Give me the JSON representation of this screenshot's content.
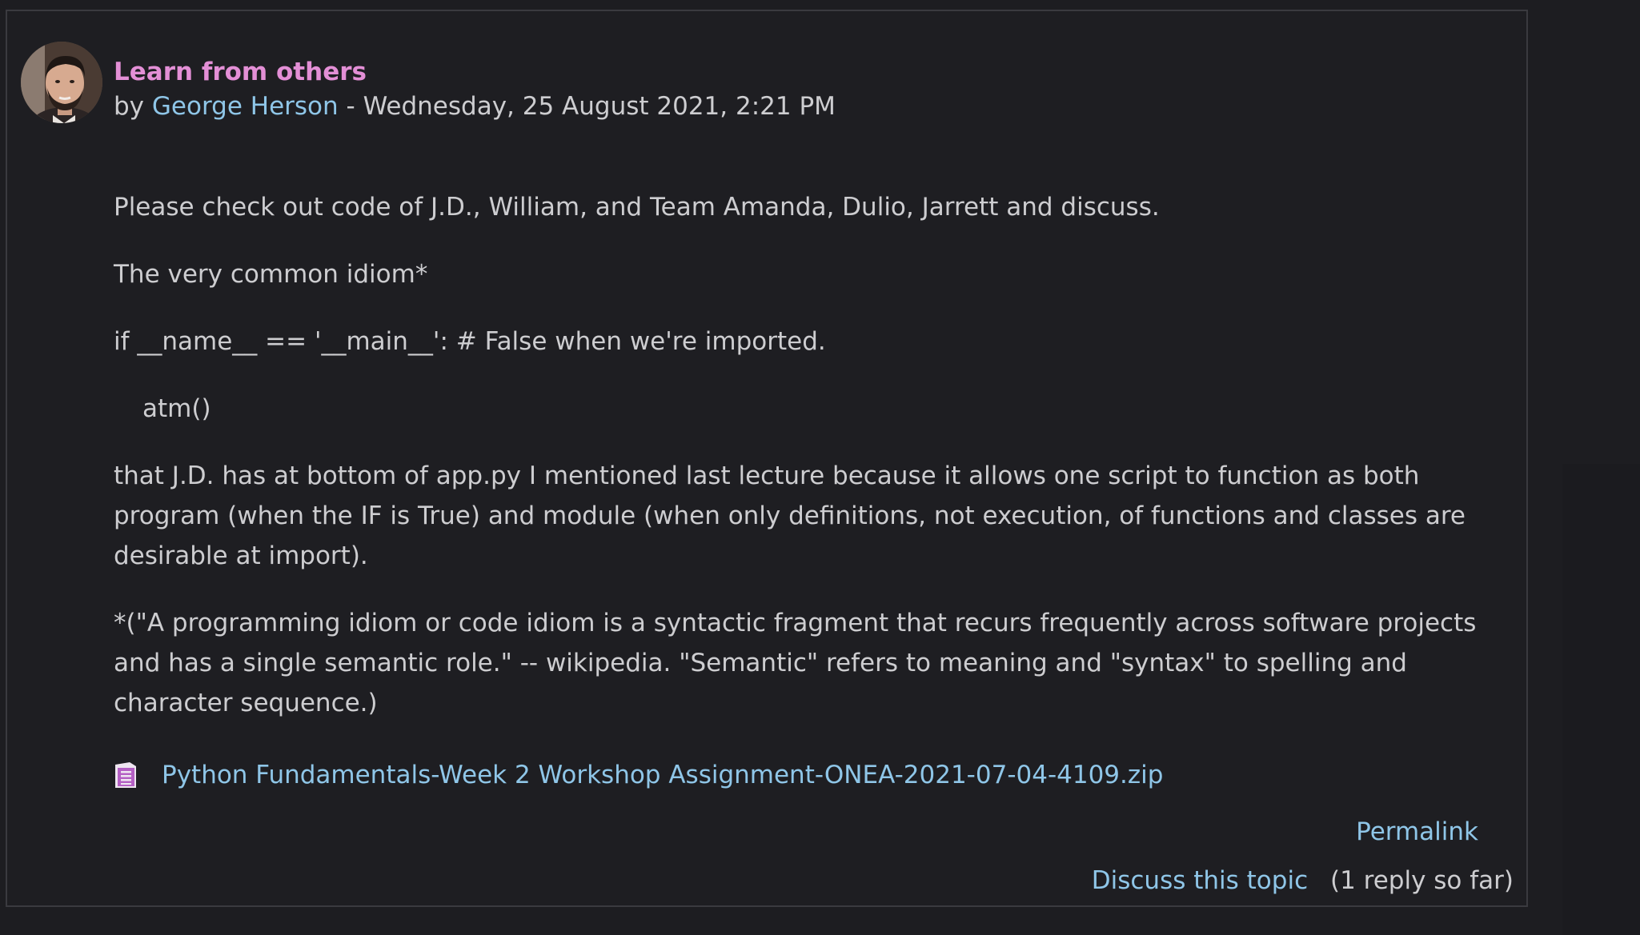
{
  "post": {
    "subject": "Learn from others",
    "by_prefix": "by",
    "author": "George Herson",
    "date_separator": "-",
    "date": "Wednesday, 25 August 2021, 2:21 PM",
    "avatar_icon": "user-avatar",
    "paragraphs": [
      "Please check out code of J.D., William, and Team Amanda, Dulio, Jarrett and discuss.",
      "The very common idiom*",
      "if __name__ == '__main__':  # False when we're imported.",
      "atm()",
      "that J.D. has at bottom of app.py I mentioned last lecture because it allows one script to function as both program (when the IF is True) and module (when only definitions, not execution, of functions and classes are desirable at import).",
      "*(\"A programming idiom or code idiom is a syntactic fragment that recurs frequently across software projects and has a single semantic role.\" -- wikipedia.  \"Semantic\" refers to meaning and \"syntax\" to spelling and character sequence.)"
    ],
    "attachment": {
      "icon": "archive-file-icon",
      "filename": "Python Fundamentals-Week 2 Workshop Assignment-ONEA-2021-07-04-4109.zip"
    },
    "permalink_label": "Permalink",
    "discuss_label": "Discuss this topic",
    "reply_count": "(1 reply so far)"
  },
  "colors": {
    "background": "#1d1d21",
    "subject": "#e38fd6",
    "link": "#8fc6e8",
    "text": "#cdcdd0",
    "border": "#3a3a3f"
  }
}
